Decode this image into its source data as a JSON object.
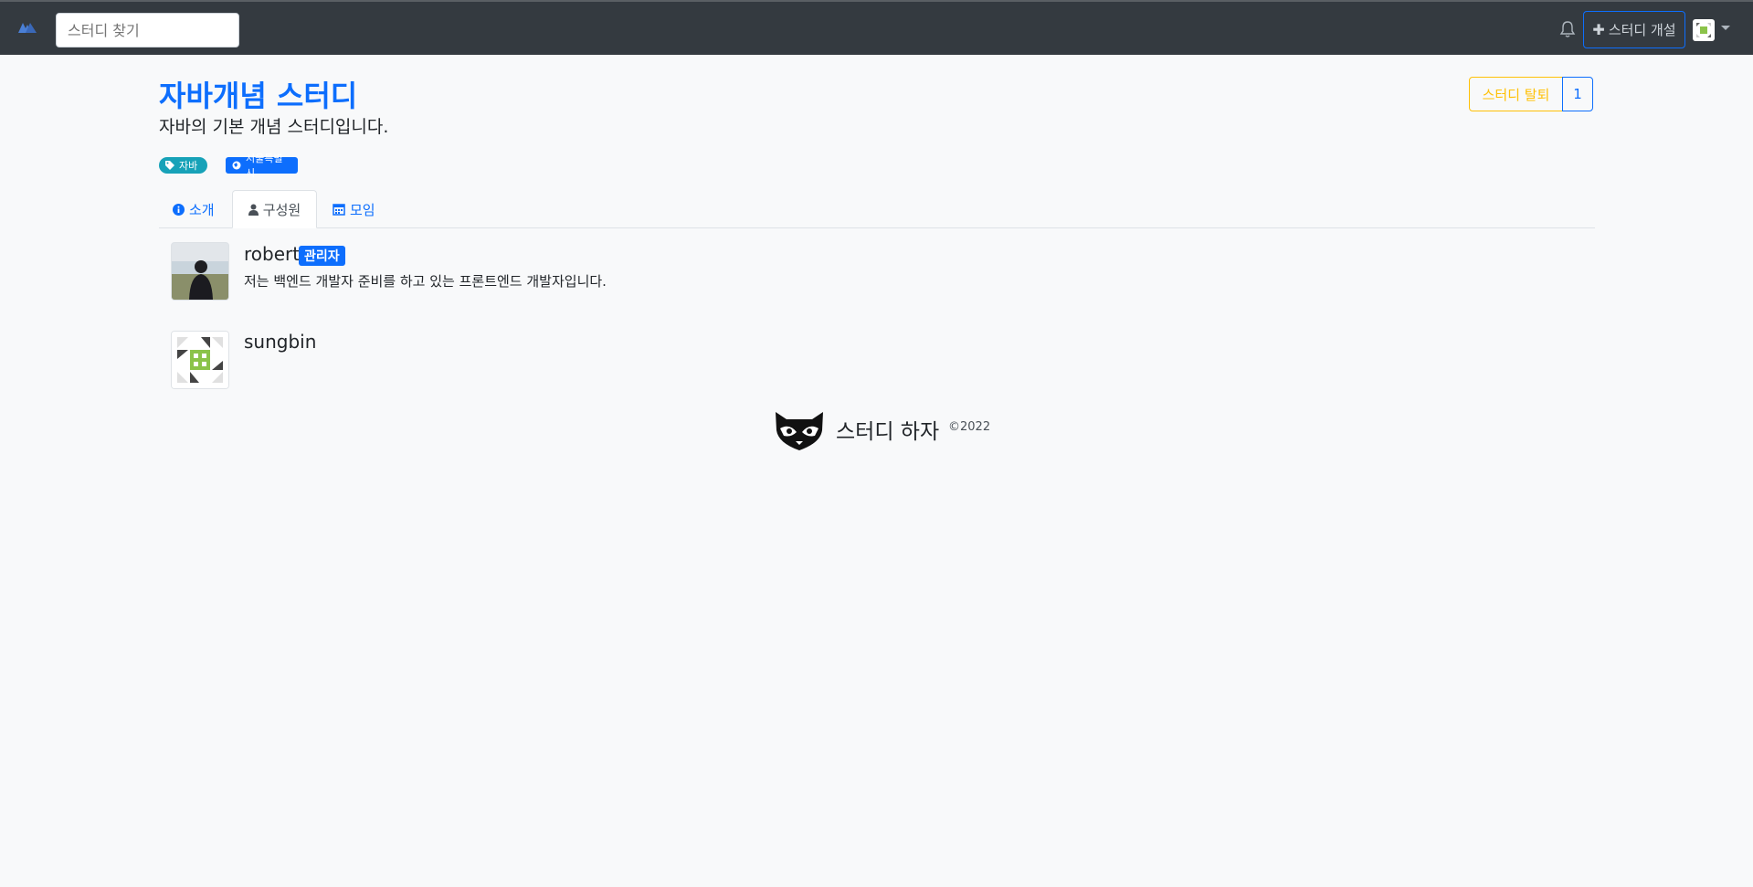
{
  "navbar": {
    "brand_icon": "mountain-logo-icon",
    "search_placeholder": "스터디 찾기",
    "notification_icon": "bell-icon",
    "open_study_label": "스터디 개설",
    "open_study_icon": "plus-icon",
    "profile_icon": "identicon-avatar"
  },
  "study": {
    "title": "자바개념 스터디",
    "description": "자바의 기본 개념 스터디입니다.",
    "leave_label": "스터디 탈퇴",
    "member_count": "1",
    "tags": [
      {
        "label": "자바",
        "icon": "tag-icon",
        "color": "#17a2b8"
      },
      {
        "label": "서울특별시",
        "icon": "globe-icon",
        "color": "#0d6efd"
      }
    ]
  },
  "tabs": [
    {
      "label": "소개",
      "icon": "info-icon",
      "active": false
    },
    {
      "label": "구성원",
      "icon": "user-icon",
      "active": true
    },
    {
      "label": "모임",
      "icon": "calendar-icon",
      "active": false
    }
  ],
  "members": [
    {
      "name": "robert",
      "role": "관리자",
      "bio": "저는 백엔드 개발자 준비를 하고 있는 프론트엔드 개발자입니다.",
      "image": "profile-photo"
    },
    {
      "name": "sungbin",
      "role": "",
      "bio": "",
      "image": "identicon-avatar"
    }
  ],
  "footer": {
    "name": "스터디 하자",
    "copyright": "©2022",
    "logo": "raccoon-logo-icon"
  },
  "colors": {
    "navbar_bg": "#343a40",
    "primary": "#0d6efd",
    "warning": "#ffc107",
    "info": "#17a2b8",
    "page_bg": "#f8f9fa"
  }
}
